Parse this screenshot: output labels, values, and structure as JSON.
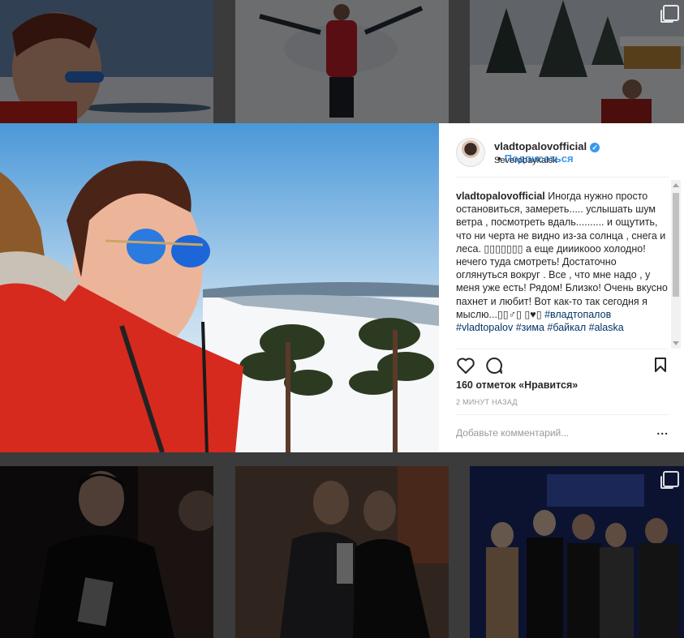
{
  "post": {
    "username": "vladtopalovofficial",
    "verified_icon": "verified-badge-icon",
    "separator": "•",
    "follow_label": "Подписаться",
    "location": "Severobaykalsk",
    "caption_username": "vladtopalovofficial",
    "caption_text": "Иногда нужно просто остановиться, замереть..... услышать шум ветра , посмотреть вдаль.......... и ощутить, что ни черта не видно из-за солнца , снега и леса. ▯▯▯▯▯▯▯ а еще дииикооо холодно! нечего туда смотреть! Достаточно оглянуться вокруг . Все , что мне надо , у меня уже есть! Рядом! Близко! Очень вкусно пахнет и любит! Вот как-то так сегодня я мыслю...▯▯♂▯ ▯♥▯",
    "hashtags": [
      "#владтопалов",
      "#vladtopalov",
      "#зима",
      "#байкал",
      "#alaska"
    ],
    "likes": "160 отметок «Нравится»",
    "time": "2 МИНУТ НАЗАД",
    "comment_placeholder": "Добавьте комментарий...",
    "more_label": "..."
  },
  "colors": {
    "accent": "#3897f0",
    "text": "#262626",
    "muted": "#999999",
    "hashtag": "#003569",
    "overlay": "#3b3b3b"
  }
}
